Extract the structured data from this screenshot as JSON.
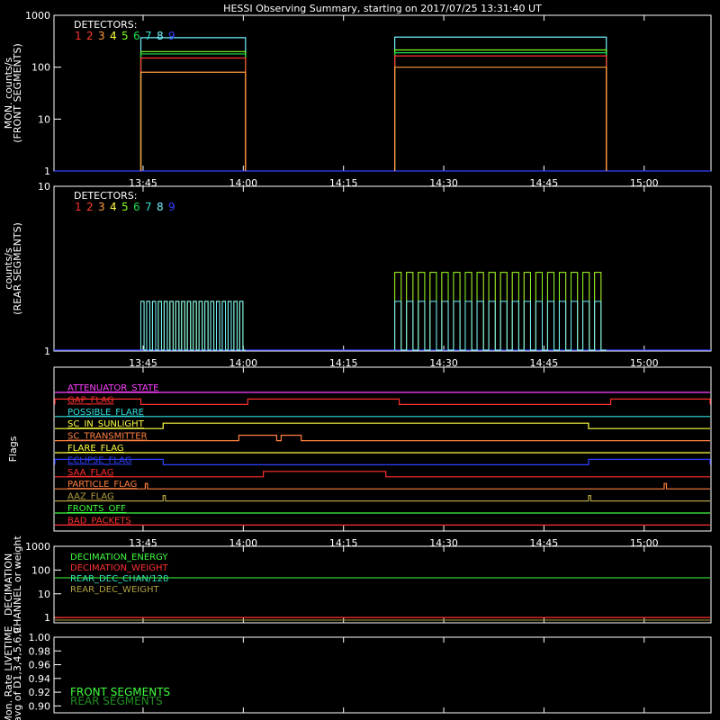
{
  "title": "HESSI Observing Summary, starting on 2017/07/25 13:31:40 UT",
  "time_ticks": [
    "13:45",
    "14:00",
    "14:15",
    "14:30",
    "14:45",
    "15:00"
  ],
  "colors": {
    "background": "#000000",
    "det": [
      "#ff3030",
      "#ff4030",
      "#ff9c3c",
      "#ffff40",
      "#80ff20",
      "#20dd50",
      "#30e0c8",
      "#70f0ff",
      "#3040ff"
    ]
  },
  "chart_data": [
    {
      "type": "line",
      "ylabel": [
        "MON. counts/s",
        "(FRONT SEGMENTS)"
      ],
      "yscale": "log",
      "ylim": [
        1,
        1000
      ],
      "y_ticks": [
        "1",
        "10",
        "100",
        "1000"
      ],
      "x_unit": "UT",
      "legend_title": "DETECTORS:",
      "legend_digits": [
        "1",
        "2",
        "3",
        "4",
        "5",
        "6",
        "7",
        "8",
        "9"
      ],
      "series": [
        {
          "name": "9",
          "segments": [
            {
              "x": [
                "13:31:40",
                "15:10:00"
              ],
              "y": 1
            }
          ]
        },
        {
          "name": "8",
          "segments": [
            {
              "x": [
                "13:44:40",
                "14:00:20"
              ],
              "y": 370
            },
            {
              "x": [
                "14:22:40",
                "14:54:20"
              ],
              "y": 380
            }
          ]
        },
        {
          "name": "5",
          "segments": [
            {
              "x": [
                "13:44:40",
                "14:00:20"
              ],
              "y": 200
            },
            {
              "x": [
                "14:22:40",
                "14:54:20"
              ],
              "y": 215
            }
          ]
        },
        {
          "name": "6",
          "segments": [
            {
              "x": [
                "13:44:40",
                "14:00:20"
              ],
              "y": 180
            },
            {
              "x": [
                "14:22:40",
                "14:54:20"
              ],
              "y": 190
            }
          ]
        },
        {
          "name": "1",
          "segments": [
            {
              "x": [
                "13:44:40",
                "14:00:20"
              ],
              "y": 150
            },
            {
              "x": [
                "14:22:40",
                "14:54:20"
              ],
              "y": 165
            }
          ]
        },
        {
          "name": "3",
          "segments": [
            {
              "x": [
                "13:44:40",
                "14:00:20"
              ],
              "y": 80
            },
            {
              "x": [
                "14:22:40",
                "14:54:20"
              ],
              "y": 100
            }
          ]
        }
      ]
    },
    {
      "type": "line",
      "ylabel": [
        "counts/s",
        "(REAR SEGMENTS)"
      ],
      "yscale": "log",
      "ylim": [
        1,
        10
      ],
      "y_ticks": [
        "1",
        "10"
      ],
      "legend_title": "DETECTORS:",
      "legend_digits": [
        "1",
        "2",
        "3",
        "4",
        "5",
        "6",
        "7",
        "8",
        "9"
      ],
      "series": [
        {
          "name": "9",
          "segments": [
            {
              "x": [
                "13:31:40",
                "15:10:00"
              ],
              "y": 1
            }
          ]
        },
        {
          "name": "1",
          "segments": [
            {
              "x": [
                "13:44:40",
                "14:00:20"
              ],
              "y": 2
            },
            {
              "x": [
                "14:22:40",
                "14:54:20"
              ],
              "y": 3
            }
          ]
        },
        {
          "name": "5",
          "segments": [
            {
              "x": [
                "13:44:40",
                "14:00:20"
              ],
              "y": 2
            },
            {
              "x": [
                "14:22:40",
                "14:54:20"
              ],
              "y": 3
            }
          ]
        },
        {
          "name": "8",
          "segments": [
            {
              "x": [
                "13:44:40",
                "14:00:20"
              ],
              "y": 2
            },
            {
              "x": [
                "14:22:40",
                "14:54:20"
              ],
              "y": 2
            }
          ]
        }
      ]
    },
    {
      "type": "line",
      "ylabel": [
        "Flags"
      ],
      "flags": [
        {
          "name": "ATTENUATOR_STATE",
          "color": "#ff40ff",
          "high": []
        },
        {
          "name": "GAP_FLAG",
          "color": "#ff3030",
          "high": [
            [
              "13:31:40",
              "13:44:40"
            ],
            [
              "14:00:40",
              "14:23:20"
            ],
            [
              "14:55:00",
              "15:10:00"
            ]
          ]
        },
        {
          "name": "POSSIBLE_FLARE",
          "color": "#30e0e0",
          "high": []
        },
        {
          "name": "SC_IN_SUNLIGHT",
          "color": "#ffff40",
          "high": [
            [
              "13:48:00",
              "14:51:40"
            ]
          ]
        },
        {
          "name": "SC_TRANSMITTER",
          "color": "#ff8040",
          "high": [
            [
              "13:59:20",
              "14:05:00"
            ],
            [
              "14:05:40",
              "14:08:40"
            ]
          ]
        },
        {
          "name": "FLARE_FLAG",
          "color": "#ffff40",
          "high": []
        },
        {
          "name": "ECLIPSE_FLAG",
          "color": "#3040ff",
          "high": [
            [
              "13:31:40",
              "13:48:00"
            ],
            [
              "14:51:40",
              "15:10:00"
            ]
          ]
        },
        {
          "name": "SAA_FLAG",
          "color": "#ff3030",
          "high": [
            [
              "14:03:00",
              "14:21:20"
            ]
          ]
        },
        {
          "name": "PARTICLE_FLAG",
          "color": "#ff8040",
          "high": [
            [
              "13:45:20",
              "13:45:40"
            ],
            [
              "15:03:00",
              "15:03:20"
            ]
          ]
        },
        {
          "name": "AAZ_FLAG",
          "color": "#b0a040",
          "high": [
            [
              "13:48:00",
              "13:48:20"
            ],
            [
              "14:51:40",
              "14:52:00"
            ]
          ]
        },
        {
          "name": "FRONTS_OFF",
          "color": "#40ff40",
          "high": []
        },
        {
          "name": "BAD_PACKETS",
          "color": "#ff3030",
          "high": []
        }
      ]
    },
    {
      "type": "line",
      "ylabel": [
        "DECIMATION",
        "CHANNEL or weight"
      ],
      "yscale": "log",
      "ylim": [
        0.6,
        1000
      ],
      "y_ticks": [
        "1",
        "10",
        "100",
        "1000"
      ],
      "series": [
        {
          "name": "DECIMATION_ENERGY",
          "color": "#40ff40",
          "y": 0
        },
        {
          "name": "DECIMATION_WEIGHT",
          "color": "#ff3030",
          "y": 1
        },
        {
          "name": "REAR_DEC_CHAN/128",
          "color": "#30e0c8",
          "y": 0
        },
        {
          "name": "REAR_DEC_WEIGHT",
          "color": "#b0a040",
          "y": 0
        }
      ]
    },
    {
      "type": "line",
      "ylabel": [
        "Mon. Rate LIVETIME",
        "avg of D1,3,4,5,6,9"
      ],
      "ylim": [
        0.89,
        1.0
      ],
      "y_ticks": [
        "0.90",
        "0.92",
        "0.94",
        "0.96",
        "0.98",
        "1.00"
      ],
      "series": [
        {
          "name": "FRONT SEGMENTS",
          "color": "#40ff40"
        },
        {
          "name": "REAR SEGMENTS",
          "color": "#209020"
        }
      ]
    }
  ]
}
